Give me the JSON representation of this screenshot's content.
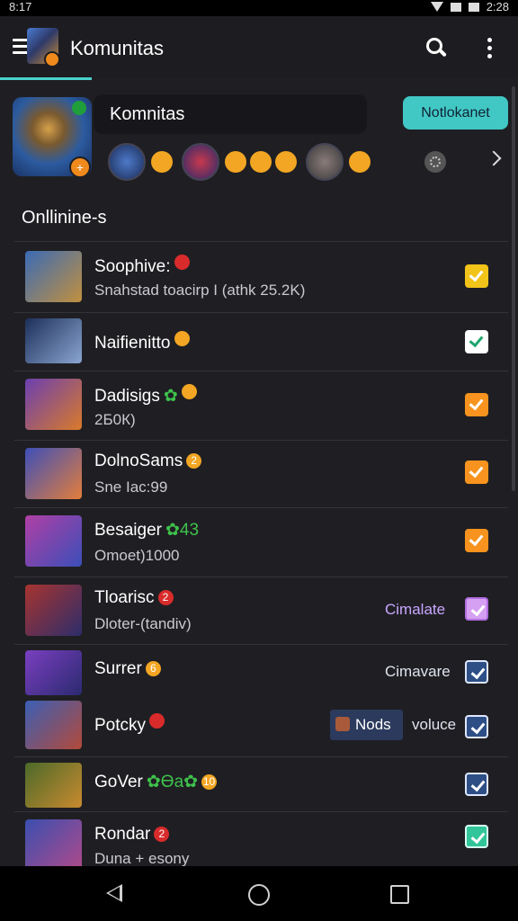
{
  "status_bar": {
    "time": "8:17",
    "battery_time": "2:28"
  },
  "app_bar": {
    "title": "Komunitas"
  },
  "community": {
    "name": "Komnitas",
    "join_label": "Notlokanet"
  },
  "section": {
    "title": "Onllinine-s"
  },
  "rows": [
    {
      "title": "Soophive:",
      "badge": "",
      "badge_color": "red",
      "extra": "",
      "subtitle": "Snahstad toacirp I (athk 25.2K)",
      "tag": "",
      "check": "yellow",
      "thumb": [
        "#3a6bb5",
        "#c2903e"
      ]
    },
    {
      "title": "Naifienitto",
      "badge": "",
      "badge_color": "orange",
      "extra": "",
      "subtitle": "",
      "tag": "",
      "check": "white",
      "thumb": [
        "#1d2f5a",
        "#8aa6d1"
      ]
    },
    {
      "title": "Dadisigs",
      "badge": "",
      "badge_color": "orange",
      "extra": "✿",
      "subtitle": "2Б0К)",
      "tag": "",
      "check": "orange",
      "thumb": [
        "#6b3fb0",
        "#d97a2a"
      ]
    },
    {
      "title": "DolnoSams",
      "badge": "2",
      "badge_color": "orange",
      "extra": "",
      "subtitle": "Sne Iac:99",
      "tag": "",
      "check": "orange",
      "thumb": [
        "#3d4fb8",
        "#e37e3b"
      ]
    },
    {
      "title": "Besaiger",
      "badge": "",
      "badge_color": "",
      "extra": "✿43",
      "subtitle": "Omoet)1000",
      "tag": "",
      "check": "orange",
      "thumb": [
        "#b03fa5",
        "#3b4fb8"
      ]
    },
    {
      "title": "Tloarisc",
      "badge": "2",
      "badge_color": "red",
      "extra": "",
      "subtitle": "Dloter-(tandiv)",
      "tag": "Cimalate",
      "check": "purple",
      "thumb": [
        "#a7342f",
        "#2d2d6b"
      ]
    },
    {
      "title": "Surrer",
      "badge": "6",
      "badge_color": "orange",
      "extra": "",
      "subtitle": "",
      "tag": "Cimavare",
      "check": "outline-blue",
      "thumb": [
        "#7a3fc0",
        "#2b2a70"
      ]
    },
    {
      "title": "Potcky",
      "badge": "",
      "badge_color": "red",
      "extra": "",
      "subtitle": "",
      "tag": "voluce",
      "chip": "Nods",
      "check": "outline-blue",
      "thumb": [
        "#3b5fb5",
        "#b24a3a"
      ]
    },
    {
      "title": "GoVer",
      "badge": "10",
      "badge_color": "orange",
      "extra": "✿Ɵa✿",
      "subtitle": "",
      "tag": "",
      "check": "outline-blue",
      "thumb": [
        "#4c6a2a",
        "#c98a2f"
      ]
    },
    {
      "title": "Rondar",
      "badge": "2",
      "badge_color": "red",
      "extra": "",
      "subtitle": "Duna + esony",
      "tag": "",
      "check": "teal",
      "thumb": [
        "#3a4fb0",
        "#b04a8a"
      ]
    }
  ]
}
